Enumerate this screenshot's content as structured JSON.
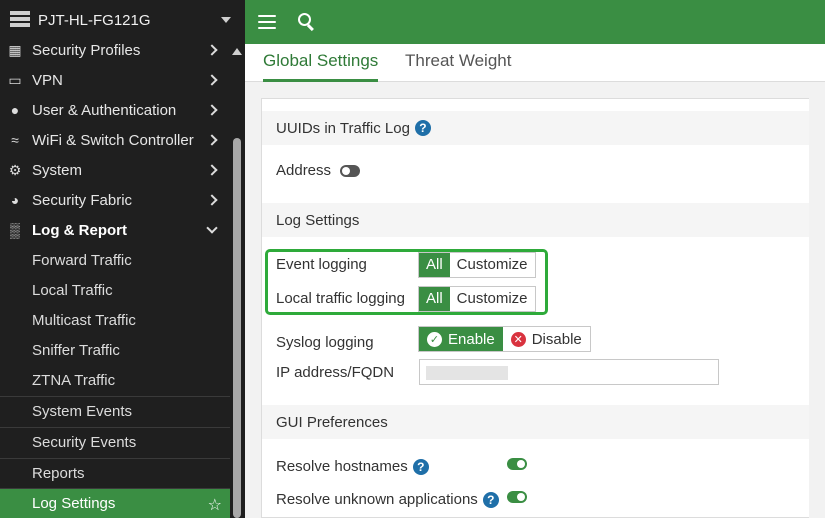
{
  "sidebar": {
    "device_name": "PJT-HL-FG121G",
    "items": [
      {
        "label": "Security Profiles",
        "icon": "shield-lock-icon"
      },
      {
        "label": "VPN",
        "icon": "laptop-icon"
      },
      {
        "label": "User & Authentication",
        "icon": "user-icon"
      },
      {
        "label": "WiFi & Switch Controller",
        "icon": "wifi-icon"
      },
      {
        "label": "System",
        "icon": "gear-icon"
      },
      {
        "label": "Security Fabric",
        "icon": "fabric-icon"
      },
      {
        "label": "Log & Report",
        "icon": "bar-chart-icon"
      }
    ],
    "subitems": [
      {
        "label": "Forward Traffic"
      },
      {
        "label": "Local Traffic"
      },
      {
        "label": "Multicast Traffic"
      },
      {
        "label": "Sniffer Traffic"
      },
      {
        "label": "ZTNA Traffic"
      },
      {
        "label": "System Events"
      },
      {
        "label": "Security Events"
      },
      {
        "label": "Reports"
      },
      {
        "label": "Log Settings"
      }
    ]
  },
  "tabs": [
    {
      "label": "Global Settings"
    },
    {
      "label": "Threat Weight"
    }
  ],
  "sections": {
    "uuids": {
      "title": "UUIDs in Traffic Log",
      "address_label": "Address"
    },
    "log_settings": {
      "title": "Log Settings",
      "event_logging": "Event logging",
      "local_traffic_logging": "Local traffic logging",
      "opt_all": "All",
      "opt_customize": "Customize",
      "syslog_logging": "Syslog logging",
      "enable": "Enable",
      "disable": "Disable",
      "ip_label": "IP address/FQDN"
    },
    "gui": {
      "title": "GUI Preferences",
      "resolve_hostnames": "Resolve hostnames",
      "resolve_unknown": "Resolve unknown applications"
    }
  },
  "colors": {
    "accent": "#3a8e43",
    "highlight": "#2eaa3a",
    "sidebar_bg": "#1f1f1f",
    "help": "#1f6fa8"
  }
}
